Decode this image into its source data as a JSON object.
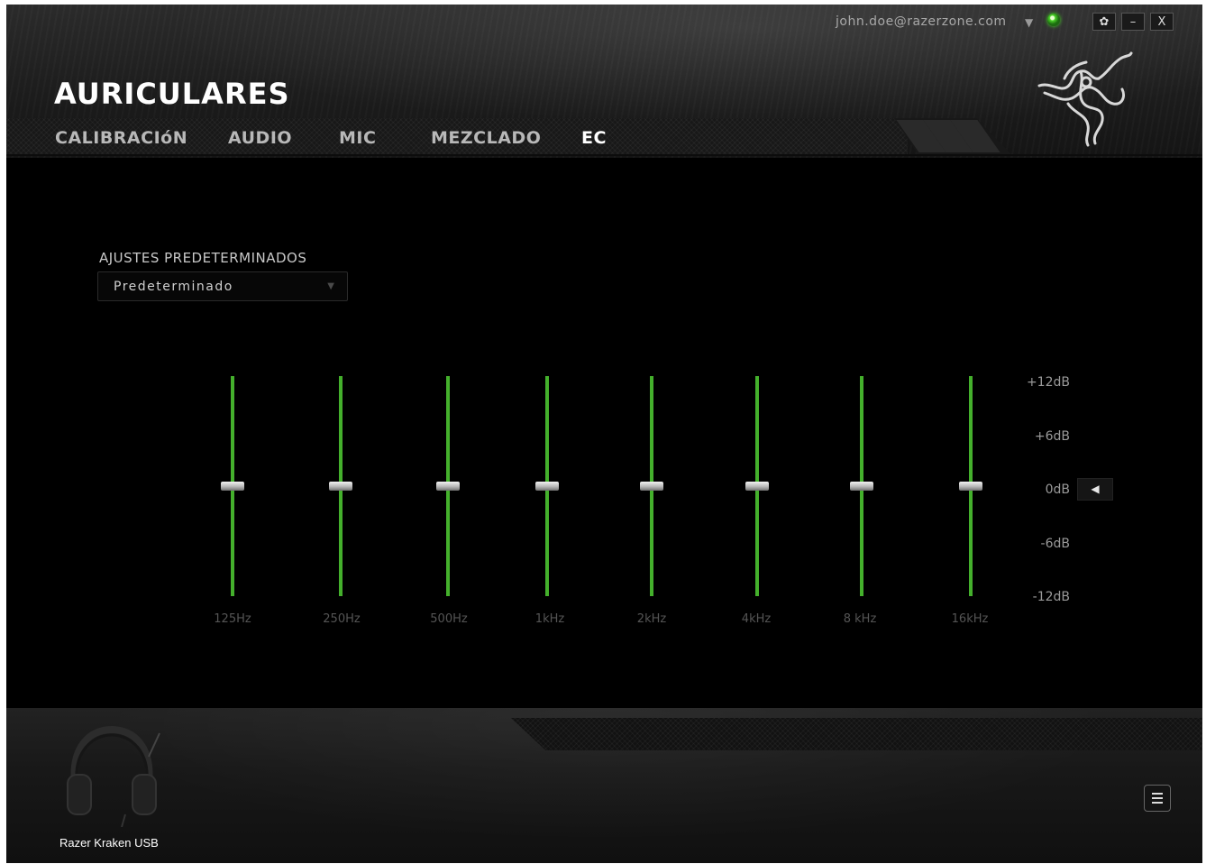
{
  "header": {
    "email": "john.doe@razerzone.com",
    "title": "AURICULARES",
    "controls": {
      "settings": "✿",
      "minimize": "–",
      "close": "X"
    }
  },
  "tabs": [
    {
      "label": "CALIBRACIóN",
      "active": false
    },
    {
      "label": "AUDIO",
      "active": false
    },
    {
      "label": "MIC",
      "active": false
    },
    {
      "label": "MEZCLADO",
      "active": false
    },
    {
      "label": "EC",
      "active": true
    }
  ],
  "preset": {
    "label": "AJUSTES PREDETERMINADOS",
    "value": "Predeterminado"
  },
  "eq": {
    "bands": [
      {
        "label": "125Hz",
        "gain_db": 0
      },
      {
        "label": "250Hz",
        "gain_db": 0
      },
      {
        "label": "500Hz",
        "gain_db": 0
      },
      {
        "label": "1kHz",
        "gain_db": 0
      },
      {
        "label": "2kHz",
        "gain_db": 0
      },
      {
        "label": "4kHz",
        "gain_db": 0
      },
      {
        "label": "8 kHz",
        "gain_db": 0
      },
      {
        "label": "16kHz",
        "gain_db": 0
      }
    ],
    "scale": [
      "+12dB",
      "+6dB",
      "0dB",
      "-6dB",
      "-12dB"
    ],
    "range_db": [
      -12,
      12
    ],
    "track_color": "#44b02c"
  },
  "footer": {
    "device_name": "Razer Kraken USB"
  },
  "colors": {
    "accent": "#44d62c",
    "background": "#000000"
  }
}
